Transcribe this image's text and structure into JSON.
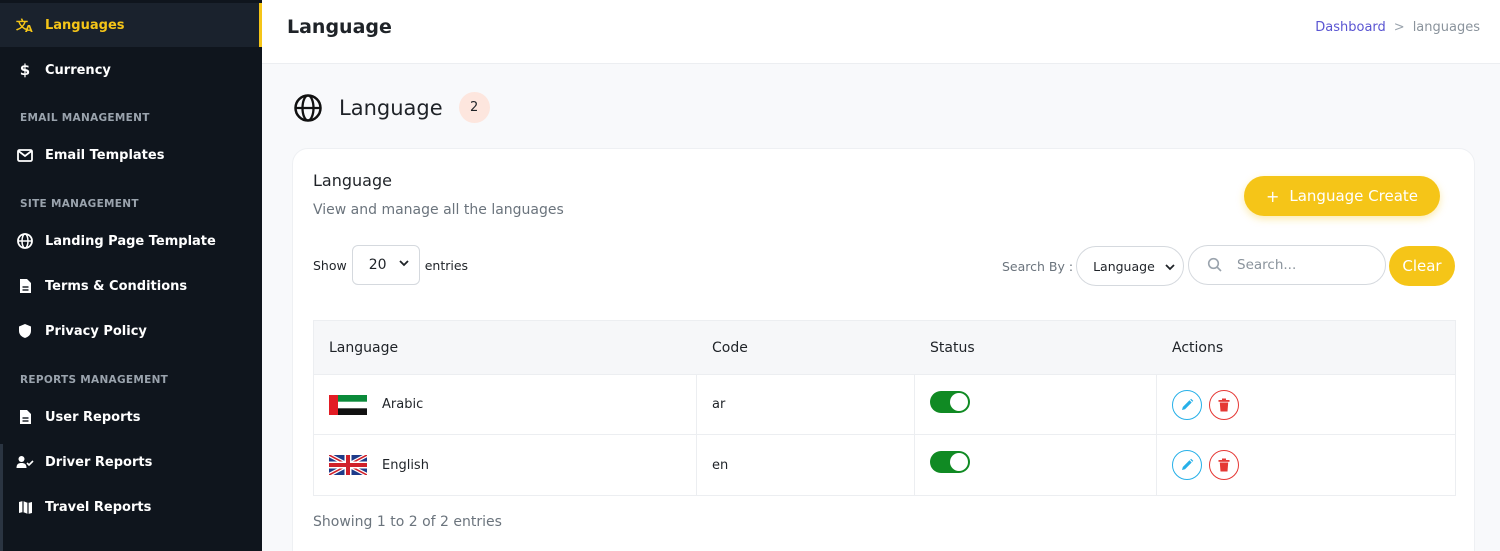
{
  "sidebar": {
    "items": [
      {
        "label": "Languages",
        "icon": "translate-icon",
        "active": true
      },
      {
        "label": "Currency",
        "icon": "dollar-icon"
      },
      {
        "label": "Email Templates",
        "icon": "mail-icon"
      },
      {
        "label": "Landing Page Template",
        "icon": "globe-icon"
      },
      {
        "label": "Terms & Conditions",
        "icon": "document-icon"
      },
      {
        "label": "Privacy Policy",
        "icon": "shield-icon"
      },
      {
        "label": "User Reports",
        "icon": "report-icon"
      },
      {
        "label": "Driver Reports",
        "icon": "user-check-icon"
      },
      {
        "label": "Travel Reports",
        "icon": "map-icon"
      }
    ],
    "sections": [
      "EMAIL MANAGEMENT",
      "SITE MANAGEMENT",
      "REPORTS MANAGEMENT"
    ]
  },
  "header": {
    "title": "Language",
    "breadcrumb": {
      "home": "Dashboard",
      "separator": ">",
      "current": "languages"
    }
  },
  "page": {
    "heading": "Language",
    "count": "2"
  },
  "card": {
    "title": "Language",
    "subtitle": "View and manage all the languages",
    "create_plus": "+",
    "create_label": "Language Create",
    "show_label": "Show",
    "entries_value": "20",
    "entries_label": "entries",
    "search_by_label": "Search By :",
    "search_by_value": "Language",
    "search_placeholder": "Search...",
    "clear_label": "Clear",
    "footer": "Showing 1 to 2 of 2 entries"
  },
  "table": {
    "columns": [
      "Language",
      "Code",
      "Status",
      "Actions"
    ],
    "rows": [
      {
        "language": "Arabic",
        "code": "ar",
        "flag": "uae-flag",
        "status": "active"
      },
      {
        "language": "English",
        "code": "en",
        "flag": "uk-flag",
        "status": "active"
      }
    ]
  },
  "colors": {
    "accent": "#f5c518",
    "sidebar_bg": "#0f151d",
    "toggle_on": "#108a23",
    "edit": "#27b0e8",
    "delete": "#e53935",
    "breadcrumb_link": "#5a55d2"
  }
}
